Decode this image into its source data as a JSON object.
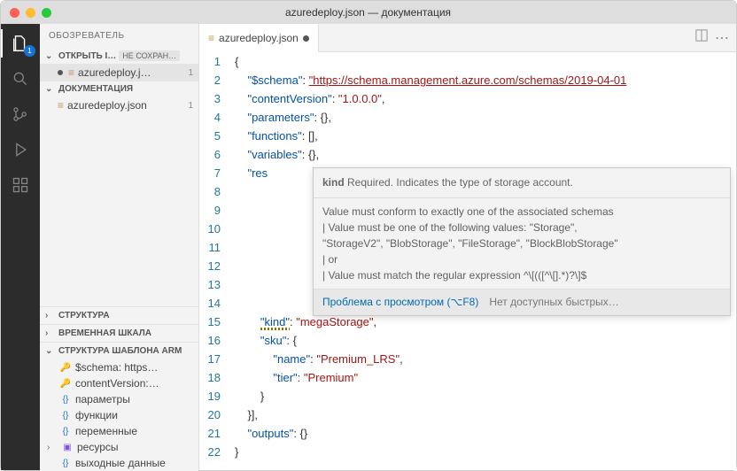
{
  "titlebar": {
    "title": "azuredeploy.json — документация"
  },
  "activity": {
    "explorer_badge": "1"
  },
  "sidebar": {
    "header": "ОБОЗРЕВАТЕЛЬ",
    "open_editors_label": "ОТКРЫТЬ I…",
    "unsaved_tag": "НЕ СОХРАН…",
    "open_file": "azuredeploy.j…",
    "open_file_badge": "1",
    "workspace_label": "ДОКУМЕНТАЦИЯ",
    "ws_file": "azuredeploy.json",
    "ws_file_badge": "1",
    "outline_header": "СТРУКТУРА",
    "timeline_header": "ВРЕМЕННАЯ ШКАЛА",
    "arm_header": "СТРУКТУРА ШАБЛОНА ARM",
    "arm_items": [
      {
        "icon": "key",
        "label": "$schema: https…"
      },
      {
        "icon": "key",
        "label": "contentVersion:…"
      },
      {
        "icon": "brace",
        "label": "параметры"
      },
      {
        "icon": "brace",
        "label": "функции"
      },
      {
        "icon": "brace",
        "label": "переменные"
      },
      {
        "icon": "cube",
        "label": "ресурсы"
      },
      {
        "icon": "brace",
        "label": "выходные данные"
      }
    ]
  },
  "tab": {
    "label": "azuredeploy.json"
  },
  "code": {
    "lines": [
      "{",
      "    \"$schema\": \"https://schema.management.azure.com/schemas/2019-04-01",
      "    \"contentVersion\": \"1.0.0.0\",",
      "    \"parameters\": {},",
      "    \"functions\": [],",
      "    \"variables\": {},",
      "    \"res",
      "",
      "",
      "",
      "",
      "",
      "",
      "",
      "        \"kind\": \"megaStorage\",",
      "        \"sku\": {",
      "            \"name\": \"Premium_LRS\",",
      "            \"tier\": \"Premium\"",
      "        }",
      "    }],",
      "    \"outputs\": {}",
      "}"
    ],
    "line_count": 22
  },
  "hover": {
    "head_strong": "kind",
    "head_rest": " Required. Indicates the type of storage account.",
    "body1": "Value must conform to exactly one of the associated schemas",
    "body2": "|   Value must be one of the following values: \"Storage\",",
    "body3": "\"StorageV2\", \"BlobStorage\", \"FileStorage\", \"BlockBlobStorage\"",
    "body4": "|   or",
    "body5": "|   Value must match the regular expression ^\\[(([^\\[].*)?\\]$",
    "foot_link": "Проблема с просмотром (⌥F8)",
    "foot_gray": "Нет доступных быстрых…"
  }
}
